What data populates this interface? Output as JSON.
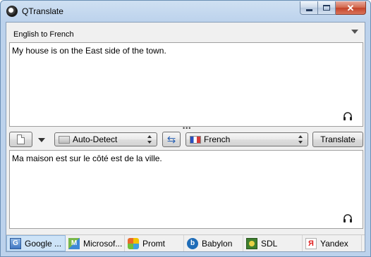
{
  "window": {
    "title": "QTranslate",
    "controls": {
      "minimize_icon": "minimize-icon",
      "maximize_icon": "maximize-icon",
      "close_icon": "close-icon"
    }
  },
  "direction": {
    "label": "English to French"
  },
  "source": {
    "text": "My house is on the East side of the town."
  },
  "toolbar": {
    "from_language": "Auto-Detect",
    "to_language": "French",
    "translate_label": "Translate",
    "swap_glyph": "⇆"
  },
  "target": {
    "text": "Ma maison est sur le côté est de la ville."
  },
  "services": [
    {
      "label": "Google ...",
      "icon": "google-icon",
      "glyph": "G",
      "active": true
    },
    {
      "label": "Microsof...",
      "icon": "microsoft-icon",
      "glyph": "M",
      "active": false
    },
    {
      "label": "Promt",
      "icon": "promt-icon",
      "glyph": "",
      "active": false
    },
    {
      "label": "Babylon",
      "icon": "babylon-icon",
      "glyph": "b",
      "active": false
    },
    {
      "label": "SDL",
      "icon": "sdl-icon",
      "glyph": "",
      "active": false
    },
    {
      "label": "Yandex",
      "icon": "yandex-icon",
      "glyph": "Я",
      "active": false
    }
  ],
  "colors": {
    "titlebar": "#bcd2ec",
    "active_tab": "#cde3f7",
    "close_button": "#c3432a"
  }
}
